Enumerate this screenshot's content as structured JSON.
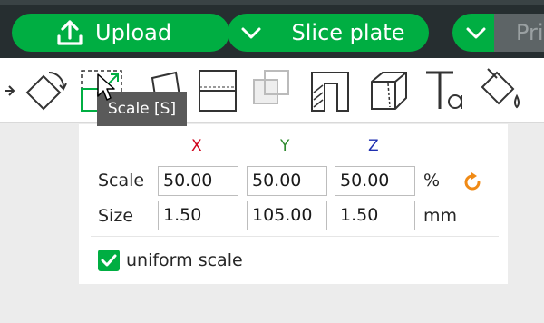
{
  "topbar": {
    "upload_label": "Upload",
    "slice_label": "Slice plate",
    "print_label": "Pri",
    "accent_color": "#00ae42"
  },
  "toolbar": {
    "tools": [
      "arrow-icon",
      "rotate-icon",
      "scale-icon",
      "lay-on-face-icon",
      "cut-icon",
      "boolean-icon",
      "support-paint-icon",
      "seam-paint-icon",
      "text-icon",
      "color-paint-icon"
    ]
  },
  "tooltip": {
    "text": "Scale [S]"
  },
  "panel": {
    "axes": {
      "x": "X",
      "y": "Y",
      "z": "Z"
    },
    "axis_colors": {
      "x": "#d0021b",
      "y": "#2e8b2e",
      "z": "#1f2fb0"
    },
    "scale": {
      "label": "Scale",
      "x": "50.00",
      "y": "50.00",
      "z": "50.00",
      "unit": "%"
    },
    "size": {
      "label": "Size",
      "x": "1.50",
      "y": "105.00",
      "z": "1.50",
      "unit": "mm"
    },
    "uniform_scale": {
      "label": "uniform scale",
      "checked": true
    }
  }
}
